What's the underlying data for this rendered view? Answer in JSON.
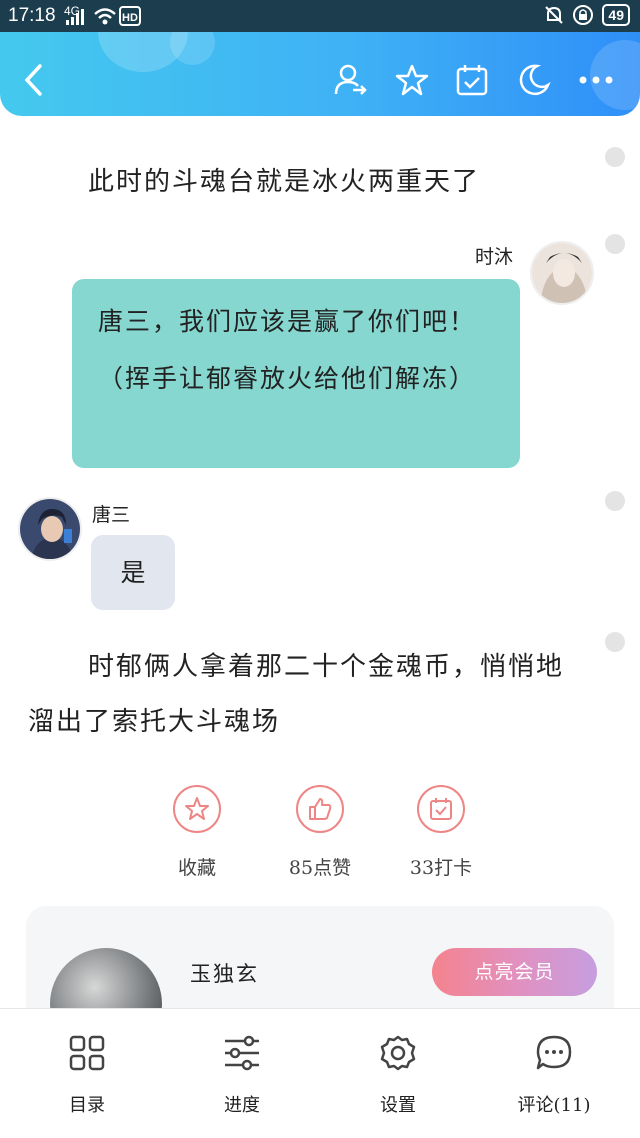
{
  "status_bar": {
    "time": "17:18",
    "network": "4G",
    "battery": "49",
    "icons": [
      "signal-icon",
      "wifi-icon",
      "hd-icon",
      "mute-bell-icon",
      "lock-rotation-icon",
      "battery-icon"
    ]
  },
  "header": {
    "icons": [
      "back-icon",
      "user-switch-icon",
      "star-icon",
      "calendar-check-icon",
      "moon-icon",
      "more-icon"
    ]
  },
  "content": {
    "para1": "此时的斗魂台就是冰火两重天了",
    "msg1": {
      "speaker": "时沐",
      "text": "唐三，我们应该是赢了你们吧！（挥手让郁睿放火给他们解冻）"
    },
    "msg2": {
      "speaker": "唐三",
      "text": "是"
    },
    "para2": "时郁俩人拿着那二十个金魂币，悄悄地溜出了索托大斗魂场"
  },
  "actions": {
    "collect": "收藏",
    "like": "85点赞",
    "checkin": "33打卡"
  },
  "author_card": {
    "name": "玉独玄",
    "vip_button": "点亮会员"
  },
  "bottom_nav": {
    "catalog": "目录",
    "progress": "进度",
    "settings": "设置",
    "comments": "评论(11)"
  },
  "colors": {
    "header_start": "#44c9ee",
    "header_end": "#2f8ff8",
    "bubble_right": "#86d7cf",
    "bubble_left": "#e2e7ef",
    "action_ring": "#ee8686"
  }
}
